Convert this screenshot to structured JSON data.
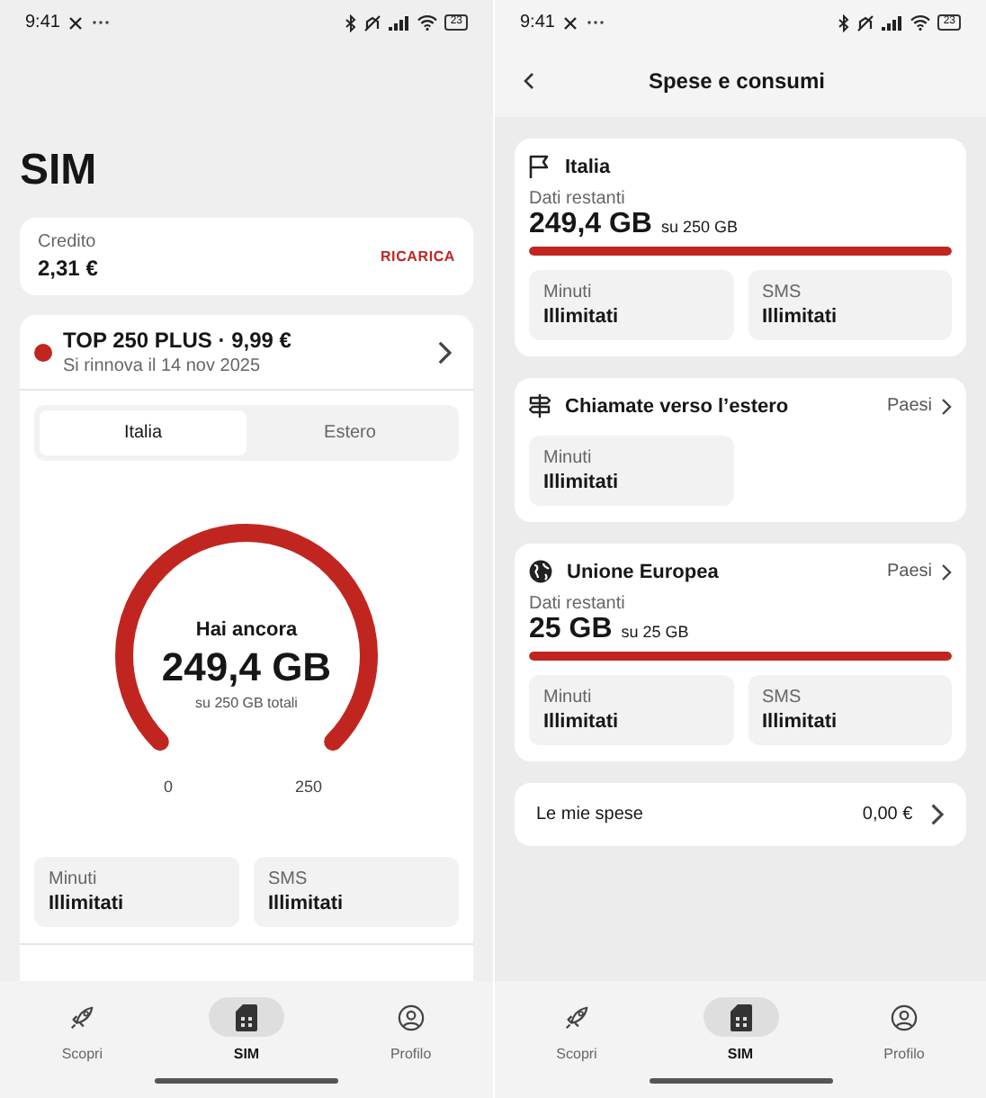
{
  "sim_screen": {
    "status_bar": {
      "time": "9:41",
      "battery": "23"
    },
    "title": "SIM",
    "credit": {
      "label": "Credito",
      "value": "2,31 €",
      "action": "RICARICA"
    },
    "plan": {
      "name": "TOP 250 PLUS · 9,99 €",
      "renewal": "Si rinnova il 14 nov 2025"
    },
    "tabs": [
      {
        "label": "Italia",
        "selected": true
      },
      {
        "label": "Estero",
        "selected": false
      }
    ],
    "gauge": {
      "caption": "Hai ancora",
      "value": "249,4 GB",
      "total": "su 250 GB totali",
      "min_label": "0",
      "max_label": "250"
    },
    "allowances": [
      {
        "label": "Minuti",
        "value": "Illimitati"
      },
      {
        "label": "SMS",
        "value": "Illimitati"
      }
    ],
    "nav": [
      {
        "label": "Scopri",
        "selected": false
      },
      {
        "label": "SIM",
        "selected": true
      },
      {
        "label": "Profilo",
        "selected": false
      }
    ]
  },
  "usage_screen": {
    "status_bar": {
      "time": "9:41",
      "battery": "23"
    },
    "header": {
      "title": "Spese e consumi"
    },
    "sections": [
      {
        "kind": "domestic",
        "title": "Italia",
        "data": {
          "label": "Dati restanti",
          "value": "249,4 GB",
          "total": "su 250 GB",
          "level": 0.998
        },
        "allowances": [
          {
            "label": "Minuti",
            "value": "Illimitati"
          },
          {
            "label": "SMS",
            "value": "Illimitati"
          }
        ]
      },
      {
        "kind": "calls_abroad",
        "title": "Chiamate verso l’estero",
        "link": "Paesi",
        "allowances": [
          {
            "label": "Minuti",
            "value": "Illimitati"
          }
        ]
      },
      {
        "kind": "roaming",
        "title": "Unione Europea",
        "link": "Paesi",
        "data": {
          "label": "Dati restanti",
          "value": "25 GB",
          "total": "su 25 GB",
          "level": 1
        },
        "allowances": [
          {
            "label": "Minuti",
            "value": "Illimitati"
          },
          {
            "label": "SMS",
            "value": "Illimitati"
          }
        ]
      }
    ],
    "expenses": {
      "label": "Le mie spese",
      "value": "0,00 €"
    },
    "nav": [
      {
        "label": "Scopri",
        "selected": false
      },
      {
        "label": "SIM",
        "selected": true
      },
      {
        "label": "Profilo",
        "selected": false
      }
    ]
  }
}
